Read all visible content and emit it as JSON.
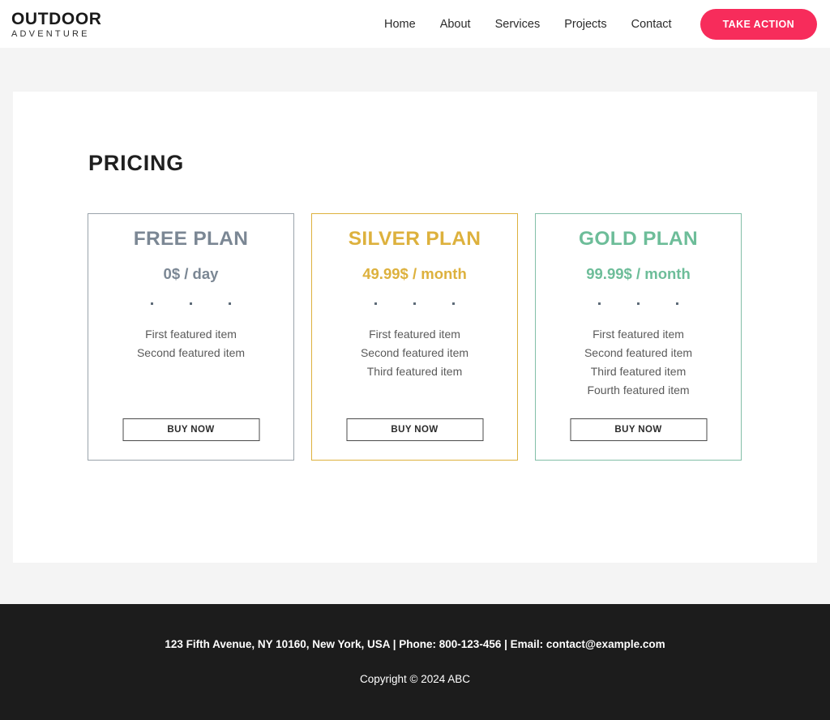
{
  "header": {
    "logo": {
      "primary": "OUTDOOR",
      "secondary": "ADVENTURE"
    },
    "nav": [
      {
        "label": "Home"
      },
      {
        "label": "About"
      },
      {
        "label": "Services"
      },
      {
        "label": "Projects"
      },
      {
        "label": "Contact"
      }
    ],
    "cta": {
      "label": "TAKE ACTION",
      "color": "#f72c5b"
    }
  },
  "main": {
    "section_title": "PRICING",
    "plans": [
      {
        "title": "FREE PLAN",
        "price": "0$ / day",
        "accent": "#7b8794",
        "border": "#9aa3ab",
        "features": [
          "First featured item",
          "Second featured item"
        ],
        "button_label": "BUY NOW"
      },
      {
        "title": "SILVER PLAN",
        "price": "49.99$ / month",
        "accent": "#ddb13d",
        "border": "#ddb13d",
        "features": [
          "First featured item",
          "Second featured item",
          "Third featured item"
        ],
        "button_label": "BUY NOW"
      },
      {
        "title": "GOLD PLAN",
        "price": "99.99$ / month",
        "accent": "#6dbd99",
        "border": "#83bfa8",
        "features": [
          "First featured item",
          "Second featured item",
          "Third featured item",
          "Fourth featured item"
        ],
        "button_label": "BUY NOW"
      }
    ]
  },
  "footer": {
    "contact": "123 Fifth Avenue, NY 10160, New York, USA | Phone: 800-123-456 | Email: contact@example.com",
    "copyright": "Copyright © 2024 ABC"
  }
}
